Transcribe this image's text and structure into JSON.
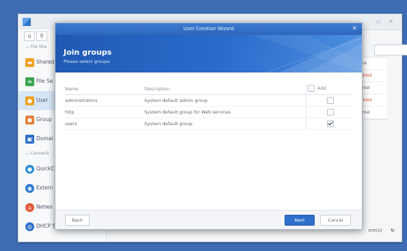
{
  "background": {
    "nav": {
      "sections": [
        "File Sha",
        "Connecti"
      ],
      "items": [
        {
          "label": "Shared",
          "icon": "shared-folder-icon",
          "color": "#f0a020"
        },
        {
          "label": "File Se",
          "icon": "file-services-icon",
          "color": "#3aa352"
        },
        {
          "label": "User",
          "icon": "user-icon",
          "color": "#f0a020"
        },
        {
          "label": "Group",
          "icon": "group-icon",
          "color": "#e2803a"
        },
        {
          "label": "Domai",
          "icon": "domain-icon",
          "color": "#2f6fc8"
        },
        {
          "label": "QuickC",
          "icon": "quickconnect-icon",
          "color": "#2f8fd8"
        },
        {
          "label": "Extern",
          "icon": "external-access-icon",
          "color": "#2f7ad0"
        },
        {
          "label": "Netwo",
          "icon": "network-icon",
          "color": "#e05a3a"
        },
        {
          "label": "DHCP Server",
          "icon": "dhcp-server-icon",
          "color": "#2f6fc8"
        }
      ]
    },
    "right_column": {
      "header": "tus",
      "cells": [
        "abled",
        "rmal",
        "abled",
        "rmal"
      ]
    },
    "footer_text": "em(s)"
  },
  "wizard": {
    "window_title": "User Creation Wizard",
    "title": "Join groups",
    "subtitle": "Please select groups:",
    "columns": {
      "name": "Name",
      "description": "Description",
      "add": "Add"
    },
    "rows": [
      {
        "name": "administrators",
        "description": "System default admin group",
        "checked": false
      },
      {
        "name": "http",
        "description": "System default group for Web services",
        "checked": false
      },
      {
        "name": "users",
        "description": "System default group",
        "checked": true
      }
    ],
    "buttons": {
      "back": "Back",
      "next": "Next",
      "cancel": "Cancel"
    }
  }
}
